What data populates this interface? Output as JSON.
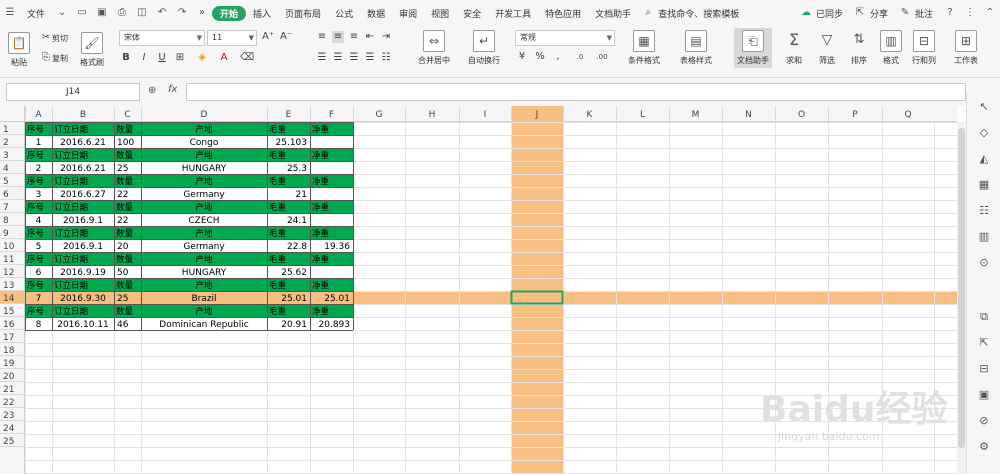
{
  "menubar": {
    "file": "文件",
    "tabs": [
      "开始",
      "插入",
      "页面布局",
      "公式",
      "数据",
      "审阅",
      "视图",
      "安全",
      "开发工具",
      "特色应用",
      "文档助手"
    ],
    "active_tab": "开始",
    "search": "查找命令、搜索模板",
    "sync": "已同步",
    "share": "分享",
    "comment": "批注"
  },
  "ribbon": {
    "paste": "粘贴",
    "cut": "剪切",
    "copy": "复制",
    "format_painter": "格式刷",
    "font_name": "宋体",
    "font_size": "11",
    "number_format": "常规",
    "merge_center": "合并居中",
    "wrap_text": "自动换行",
    "conditional_format": "条件格式",
    "table_style": "表格样式",
    "doc_helper": "文档助手",
    "sum": "求和",
    "filter": "筛选",
    "sort": "排序",
    "format": "格式",
    "row_col": "行和列",
    "worksheet": "工作表"
  },
  "formula_bar": {
    "name_box": "J14",
    "fx": "fx",
    "value": ""
  },
  "sheet": {
    "columns": [
      "A",
      "B",
      "C",
      "D",
      "E",
      "F",
      "G",
      "H",
      "I",
      "J",
      "K",
      "L",
      "M",
      "N",
      "O",
      "P",
      "Q"
    ],
    "selected_column": "J",
    "selected_row": 14,
    "header_labels": [
      "序号",
      "订立日期",
      "数量",
      "产地",
      "毛重",
      "净重"
    ],
    "records": [
      {
        "no": "1",
        "date": "2016.6.21",
        "qty": "100",
        "origin": "Congo",
        "gross": "25.103",
        "net": ""
      },
      {
        "no": "2",
        "date": "2016.6.21",
        "qty": "25",
        "origin": "HUNGARY",
        "gross": "25.3",
        "net": ""
      },
      {
        "no": "3",
        "date": "2016.6.27",
        "qty": "22",
        "origin": "Germany",
        "gross": "21",
        "net": ""
      },
      {
        "no": "4",
        "date": "2016.9.1",
        "qty": "22",
        "origin": "CZECH",
        "gross": "24.1",
        "net": ""
      },
      {
        "no": "5",
        "date": "2016.9.1",
        "qty": "20",
        "origin": "Germany",
        "gross": "22.8",
        "net": "19.36"
      },
      {
        "no": "6",
        "date": "2016.9.19",
        "qty": "50",
        "origin": "HUNGARY",
        "gross": "25.62",
        "net": ""
      },
      {
        "no": "7",
        "date": "2016.9.30",
        "qty": "25",
        "origin": "Brazil",
        "gross": "25.01",
        "net": "25.01"
      },
      {
        "no": "8",
        "date": "2016.10.11",
        "qty": "46",
        "origin": "Dominican Republic",
        "gross": "20.91",
        "net": "20.893"
      }
    ],
    "row_count": 25
  },
  "colors": {
    "header_green": "#00a94f",
    "highlight_orange": "#f9be82",
    "selection_green": "#21a464"
  },
  "watermark": {
    "brand": "Baidu经验",
    "url": "jingyan.baidu.com"
  }
}
